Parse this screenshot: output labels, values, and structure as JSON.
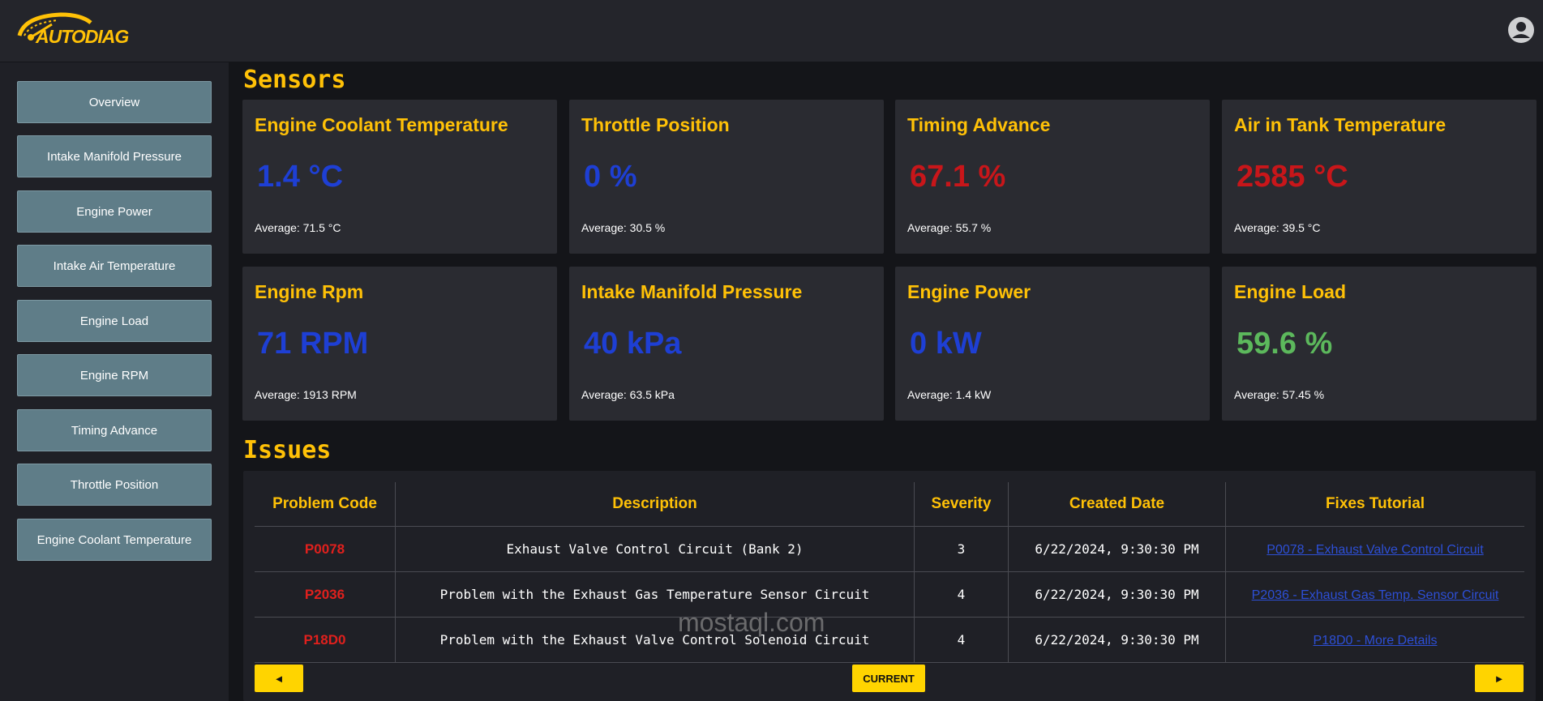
{
  "header": {
    "logo_text": "AUTODIAG",
    "colors": {
      "accent": "#ffc107",
      "blue": "#1e3fd4",
      "red": "#c8161a",
      "green": "#5cb85c"
    }
  },
  "sidebar": {
    "items": [
      {
        "label": "Overview"
      },
      {
        "label": "Intake Manifold Pressure"
      },
      {
        "label": "Engine Power"
      },
      {
        "label": "Intake Air Temperature"
      },
      {
        "label": "Engine Load"
      },
      {
        "label": "Engine RPM"
      },
      {
        "label": "Timing Advance"
      },
      {
        "label": "Throttle Position"
      },
      {
        "label": "Engine Coolant Temperature"
      }
    ]
  },
  "sensors": {
    "title": "Sensors",
    "cards": [
      {
        "title": "Engine Coolant Temperature",
        "value": "1.4 °C",
        "average": "Average: 71.5 °C",
        "status": "blue"
      },
      {
        "title": "Throttle Position",
        "value": "0 %",
        "average": "Average: 30.5 %",
        "status": "blue"
      },
      {
        "title": "Timing Advance",
        "value": "67.1 %",
        "average": "Average: 55.7 %",
        "status": "red"
      },
      {
        "title": "Air in Tank Temperature",
        "value": "2585 °C",
        "average": "Average: 39.5 °C",
        "status": "red"
      },
      {
        "title": "Engine Rpm",
        "value": "71 RPM",
        "average": "Average: 1913 RPM",
        "status": "blue"
      },
      {
        "title": "Intake Manifold Pressure",
        "value": "40 kPa",
        "average": "Average: 63.5 kPa",
        "status": "blue"
      },
      {
        "title": "Engine Power",
        "value": "0 kW",
        "average": "Average: 1.4 kW",
        "status": "blue"
      },
      {
        "title": "Engine Load",
        "value": "59.6 %",
        "average": "Average: 57.45 %",
        "status": "green"
      }
    ]
  },
  "issues": {
    "title": "Issues",
    "columns": [
      "Problem Code",
      "Description",
      "Severity",
      "Created Date",
      "Fixes Tutorial"
    ],
    "rows": [
      {
        "code": "P0078",
        "description": "Exhaust Valve Control Circuit (Bank 2)",
        "severity": "3",
        "date": "6/22/2024, 9:30:30 PM",
        "tutorial": "P0078 - Exhaust Valve Control Circuit"
      },
      {
        "code": "P2036",
        "description": "Problem with the Exhaust Gas Temperature Sensor Circuit",
        "severity": "4",
        "date": "6/22/2024, 9:30:30 PM",
        "tutorial": "P2036 - Exhaust Gas Temp. Sensor Circuit"
      },
      {
        "code": "P18D0",
        "description": "Problem with the Exhaust Valve Control Solenoid Circuit",
        "severity": "4",
        "date": "6/22/2024, 9:30:30 PM",
        "tutorial": "P18D0 - More Details"
      }
    ],
    "pager": {
      "prev": "◄",
      "current": "CURRENT",
      "next": "►"
    }
  },
  "watermark": "mostaql.com"
}
